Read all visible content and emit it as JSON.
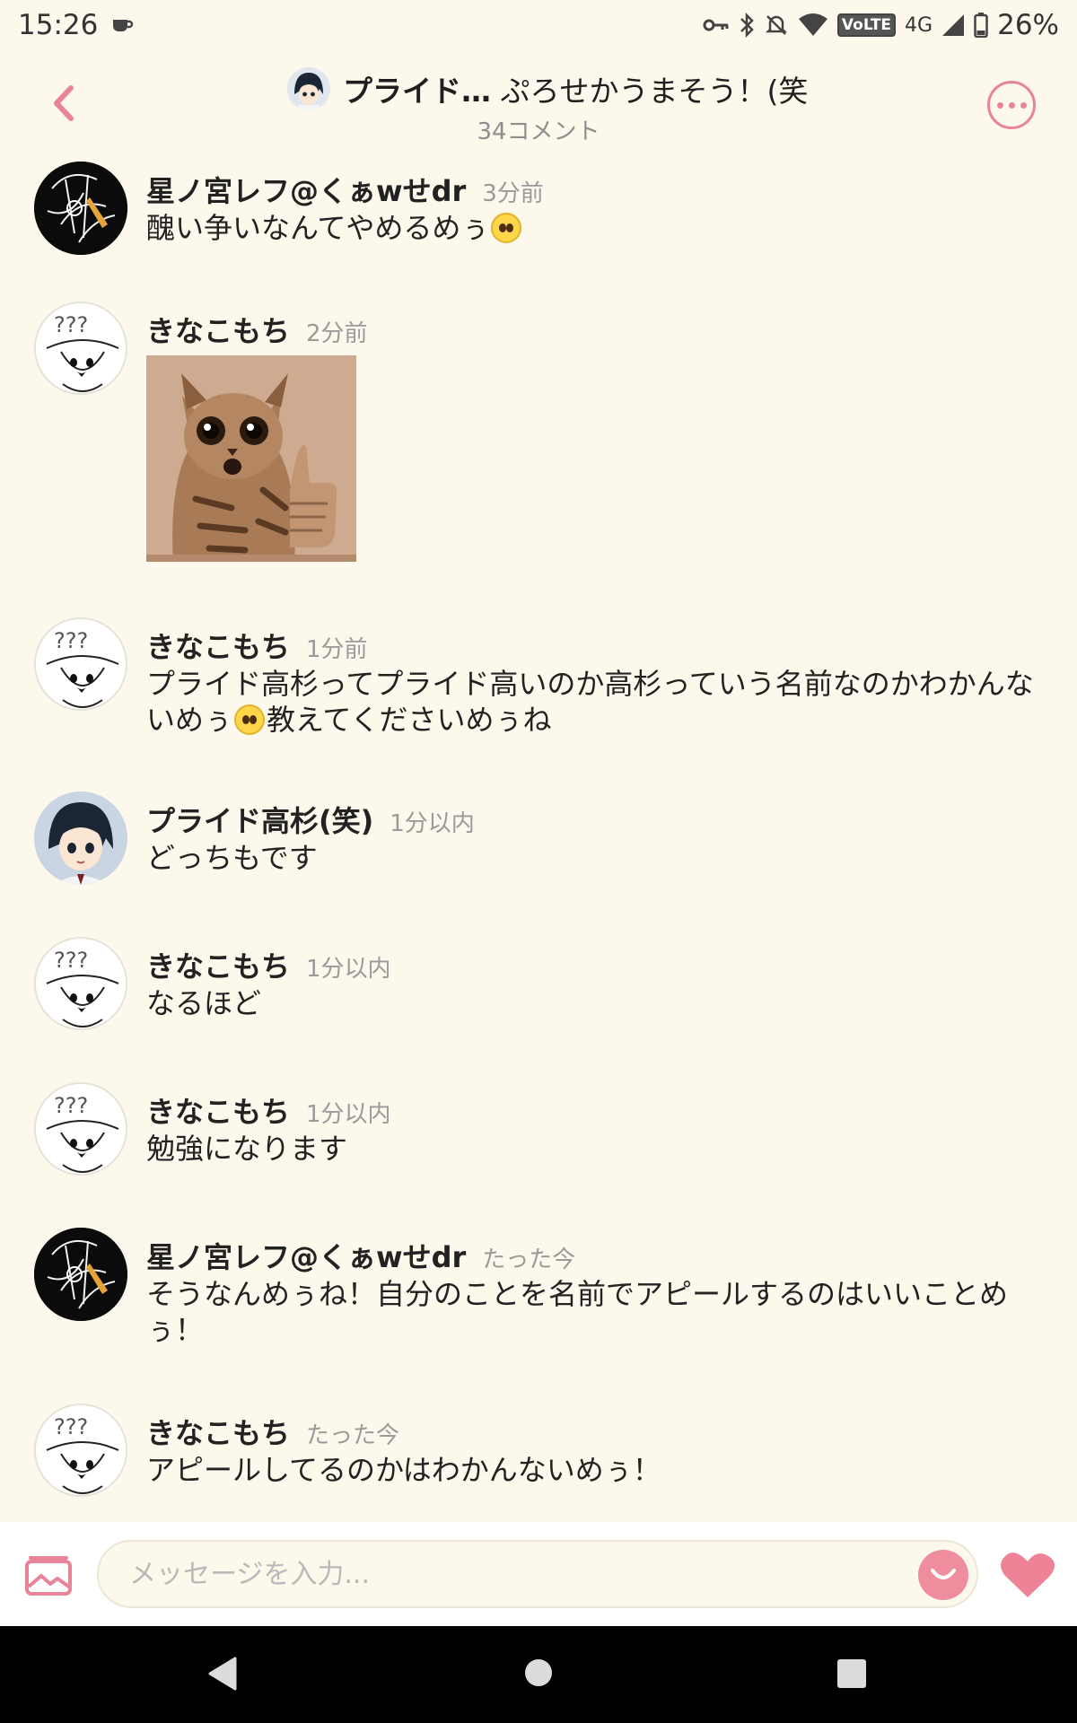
{
  "status_bar": {
    "time": "15:26",
    "network": "4G",
    "volte": "VoLTE",
    "battery": "26%",
    "icons": [
      "cup-icon",
      "key-icon",
      "bluetooth-icon",
      "bell-off-icon",
      "wifi-icon",
      "signal-icon",
      "battery-icon"
    ]
  },
  "header": {
    "title_name": "プライド…",
    "title_rest": "ぷろせかうまそう！(笑",
    "comment_count": "34コメント",
    "colors": {
      "accent": "#e9839a",
      "back": "#e9839a"
    }
  },
  "comments": [
    {
      "name": "星ノ宮レフ@くぁwせdr",
      "time": "3分前",
      "text_parts": [
        "醜い争いなんてやめるめぅ",
        ""
      ],
      "avatar": "dark"
    },
    {
      "name": "きなこもち",
      "time": "2分前",
      "image": "cat-thumbs-up",
      "avatar": "white"
    },
    {
      "name": "きなこもち",
      "time": "1分前",
      "text_parts": [
        "プライド高杉ってプライド高いのか高杉っていう名前なのかわかんないめぅ",
        "教えてくださいめぅね"
      ],
      "avatar": "white"
    },
    {
      "name": "プライド高杉(笑)",
      "time": "1分以内",
      "text": "どっちもです",
      "avatar": "anime"
    },
    {
      "name": "きなこもち",
      "time": "1分以内",
      "text": "なるほど",
      "avatar": "white"
    },
    {
      "name": "きなこもち",
      "time": "1分以内",
      "text": "勉強になります",
      "avatar": "white"
    },
    {
      "name": "星ノ宮レフ@くぁwせdr",
      "time": "たった今",
      "text": "そうなんめぅね！自分のことを名前でアピールするのはいいことめぅ！",
      "avatar": "dark"
    },
    {
      "name": "きなこもち",
      "time": "たった今",
      "text": "アピールしてるのかはわかんないめぅ！",
      "avatar": "white"
    }
  ],
  "input_bar": {
    "placeholder": "メッセージを入力...",
    "value": ""
  }
}
